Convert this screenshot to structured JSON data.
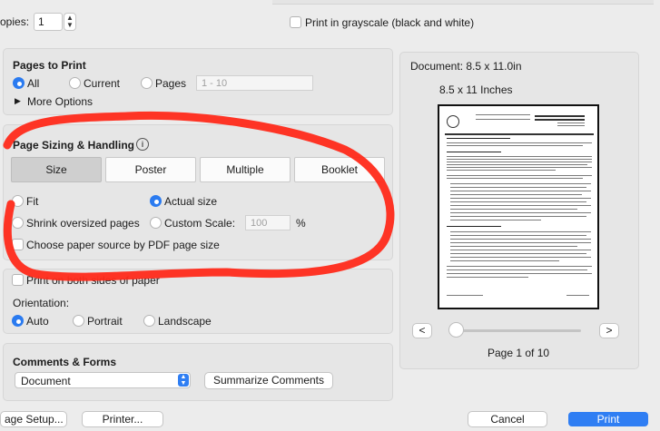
{
  "copies": {
    "label": "opies:",
    "value": "1"
  },
  "grayscale": {
    "label": "Print in grayscale (black and white)",
    "checked": false
  },
  "pages_to_print": {
    "title": "Pages to Print",
    "options": [
      "All",
      "Current",
      "Pages"
    ],
    "selected": "All",
    "range_placeholder": "1 - 10",
    "more_options": "More Options"
  },
  "page_sizing": {
    "title": "Page Sizing & Handling",
    "tabs": [
      "Size",
      "Poster",
      "Multiple",
      "Booklet"
    ],
    "selected_tab": "Size",
    "fit": "Fit",
    "actual_size": "Actual size",
    "shrink": "Shrink oversized pages",
    "custom_scale": "Custom Scale:",
    "scale_value": "100",
    "percent": "%",
    "choose_source": "Choose paper source by PDF page size",
    "selected_option": "Actual size"
  },
  "orientation_panel": {
    "both_sides": "Print on both sides of paper",
    "orientation_label": "Orientation:",
    "options": [
      "Auto",
      "Portrait",
      "Landscape"
    ],
    "selected": "Auto"
  },
  "comments_forms": {
    "title": "Comments & Forms",
    "select_value": "Document",
    "summarize_button": "Summarize Comments"
  },
  "preview": {
    "document_label": "Document: 8.5 x 11.0in",
    "paper_label": "8.5 x 11 Inches",
    "page_indicator": "Page 1 of 10",
    "prev": "<",
    "next": ">",
    "slider_position": 0
  },
  "footer": {
    "page_setup": "age Setup...",
    "printer": "Printer...",
    "cancel": "Cancel",
    "print": "Print"
  },
  "colors": {
    "accent": "#2f7ef3",
    "annotation": "#ff2a1a"
  }
}
